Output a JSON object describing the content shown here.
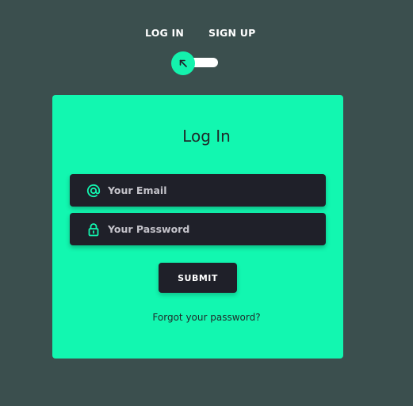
{
  "tabs": {
    "login_label": "LOG IN",
    "signup_label": "SIGN UP"
  },
  "toggle": {
    "icon": "arrow-up-left-icon",
    "state": "log-in"
  },
  "card": {
    "title": "Log In",
    "email": {
      "icon": "at-sign-icon",
      "placeholder": "Your Email",
      "value": ""
    },
    "password": {
      "icon": "lock-icon",
      "placeholder": "Your Password",
      "value": ""
    },
    "submit_label": "SUBMIT",
    "forgot_label": "Forgot your password?"
  },
  "colors": {
    "background": "#3b4f4e",
    "accent": "#12f7b0",
    "dark": "#1f2029",
    "text_on_accent": "#1f2a2a"
  }
}
